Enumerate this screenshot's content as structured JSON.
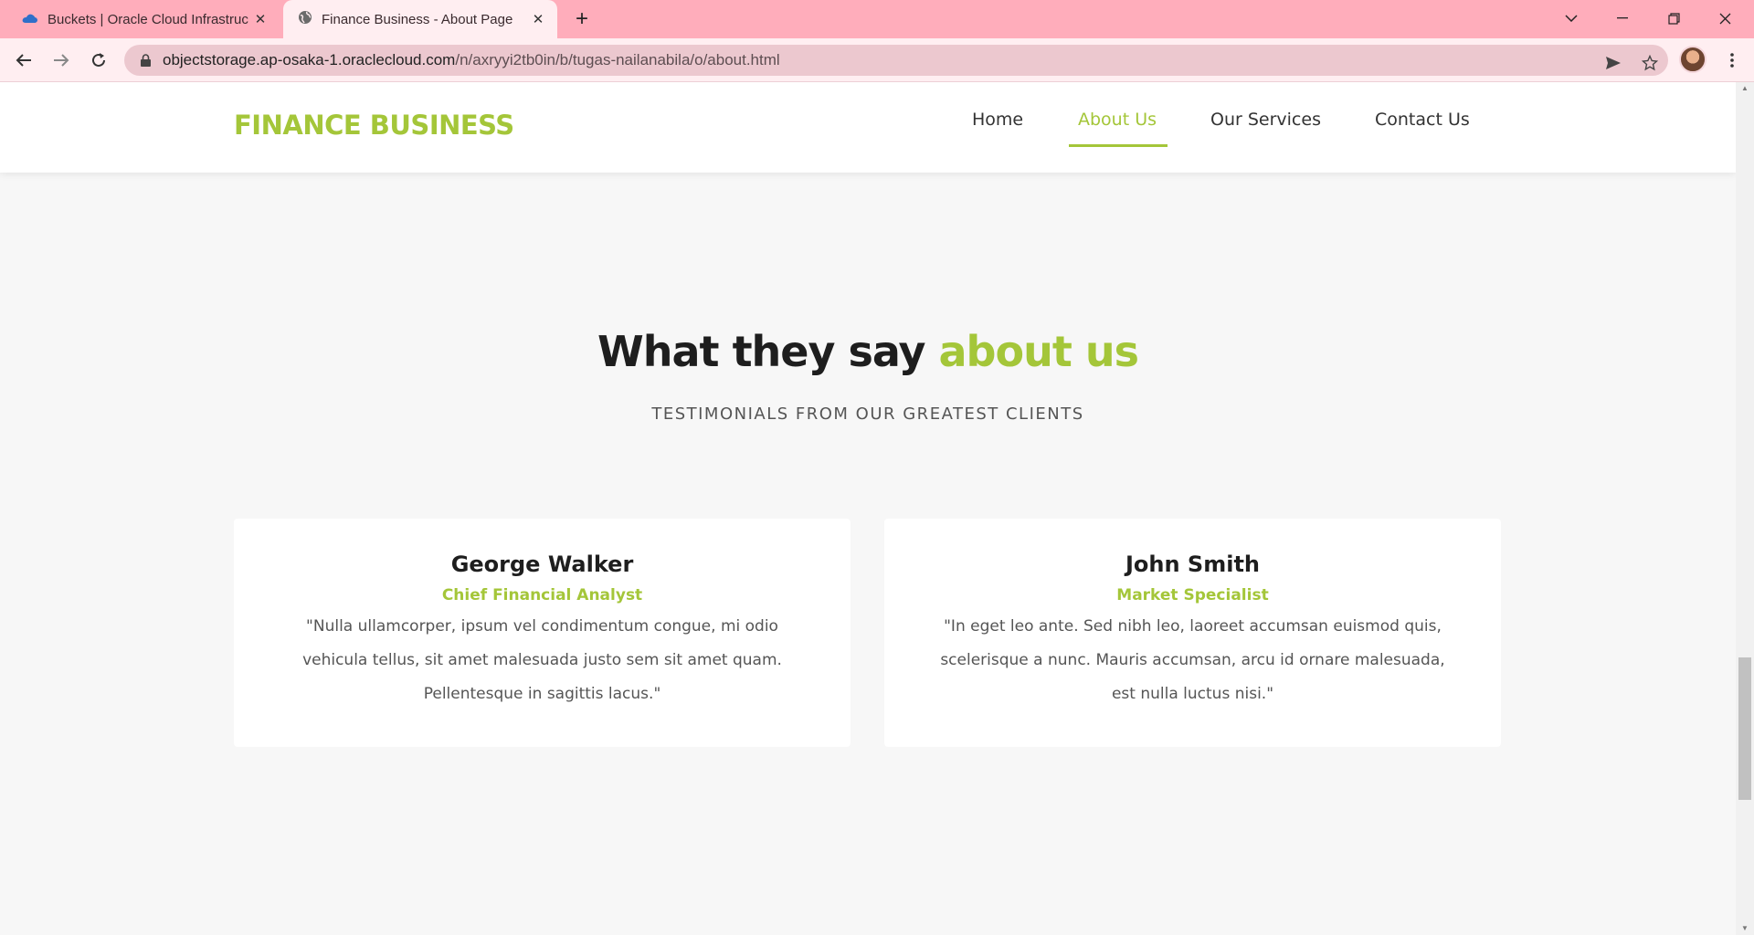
{
  "browser": {
    "tabs": [
      {
        "title": "Buckets | Oracle Cloud Infrastructure",
        "active": false,
        "icon": "cloud-icon"
      },
      {
        "title": "Finance Business - About Page",
        "active": true,
        "icon": "globe-icon"
      }
    ],
    "url_host": "objectstorage.ap-osaka-1.oraclecloud.com",
    "url_path": "/n/axryyi2tb0in/b/tugas-nailanabila/o/about.html"
  },
  "site": {
    "logo": "FINANCE BUSINESS",
    "nav": [
      "Home",
      "About Us",
      "Our Services",
      "Contact Us"
    ],
    "active_nav": "About Us"
  },
  "section": {
    "title_main": "What they say",
    "title_accent": "about us",
    "subtitle": "TESTIMONIALS FROM OUR GREATEST CLIENTS"
  },
  "testimonials": [
    {
      "name": "George Walker",
      "role": "Chief Financial Analyst",
      "quote": "\"Nulla ullamcorper, ipsum vel condimentum congue, mi odio vehicula tellus, sit amet malesuada justo sem sit amet quam. Pellentesque in sagittis lacus.\""
    },
    {
      "name": "John Smith",
      "role": "Market Specialist",
      "quote": "\"In eget leo ante. Sed nibh leo, laoreet accumsan euismod quis, scelerisque a nunc. Mauris accumsan, arcu id ornare malesuada, est nulla luctus nisi.\""
    }
  ],
  "colors": {
    "accent": "#a4c639",
    "tabbar": "#ffadbb",
    "toolbar": "#ffeef1"
  }
}
